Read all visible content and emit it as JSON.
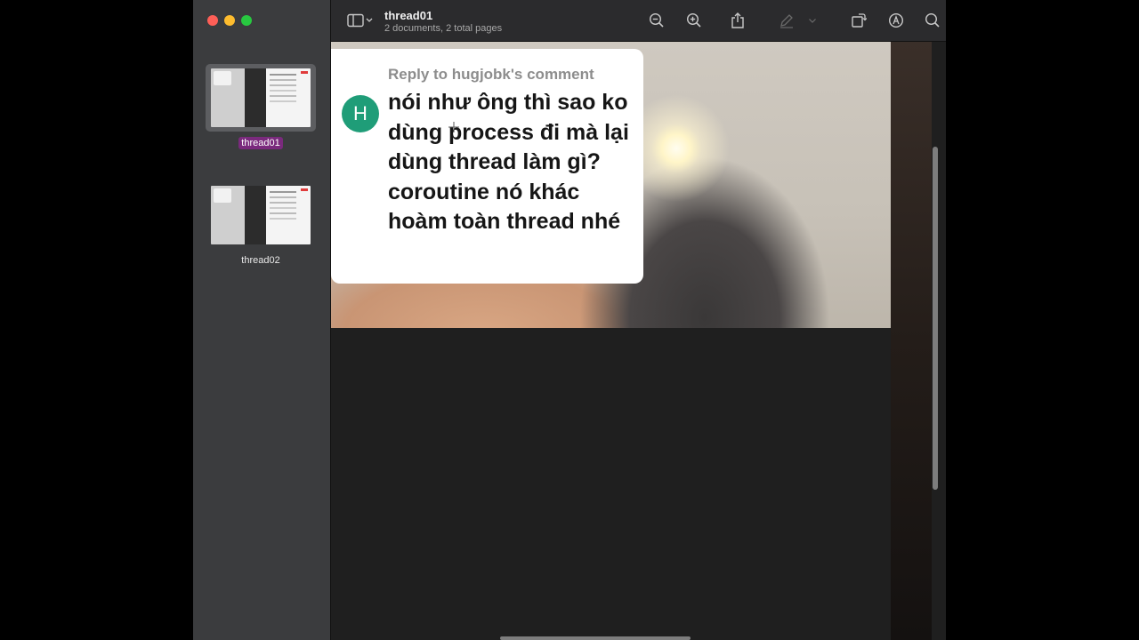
{
  "window": {
    "title": "thread01",
    "subtitle": "2 documents, 2 total pages"
  },
  "sidebar": {
    "documents": [
      {
        "label": "thread01",
        "selected": true
      },
      {
        "label": "thread02",
        "selected": false
      }
    ]
  },
  "toolbar": {
    "icons": [
      "sidebar-toggle-icon",
      "chevron-down-icon",
      "zoom-out-icon",
      "zoom-in-icon",
      "share-icon",
      "markup-pen-icon",
      "chevron-down-icon",
      "rotate-icon",
      "annotate-icon",
      "search-icon"
    ]
  },
  "comment": {
    "reply_to": "Reply to hugjobk's comment",
    "avatar_letter": "H",
    "text": "nói như ông thì sao ko dùng process đi mà lại dùng thread làm gì? coroutine nó khác hoàm toàn thread nhé"
  },
  "colors": {
    "avatar": "#1f9d78",
    "selection": "#7a2a7d",
    "sidebar_bg": "#3b3c3e",
    "toolbar_bg": "#2b2b2d"
  }
}
